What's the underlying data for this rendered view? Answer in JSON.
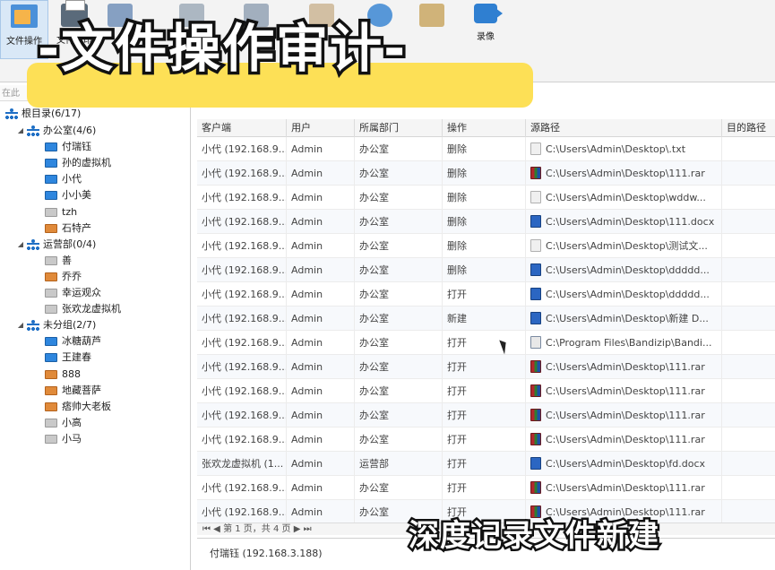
{
  "toolbar": {
    "buttons": [
      {
        "label": "文件操作",
        "icon": "folder-icon",
        "active": true
      },
      {
        "label": "文件打印",
        "icon": "printer-icon"
      },
      {
        "label": "录像",
        "icon": "camera-icon"
      }
    ]
  },
  "banner": "-文件操作审计-",
  "search_strip": "在此",
  "tree": {
    "root": "根目录(6/17)",
    "groups": [
      {
        "name": "办公室(4/6)",
        "items": [
          {
            "name": "付瑞钰",
            "status": "online"
          },
          {
            "name": "孙的虚拟机",
            "status": "online"
          },
          {
            "name": "小代",
            "status": "online"
          },
          {
            "name": "小小美",
            "status": "online"
          },
          {
            "name": "tzh",
            "status": "offline"
          },
          {
            "name": "石特产",
            "status": "warn"
          }
        ]
      },
      {
        "name": "运营部(0/4)",
        "items": [
          {
            "name": "善",
            "status": "offline"
          },
          {
            "name": "乔乔",
            "status": "warn"
          },
          {
            "name": "幸运观众",
            "status": "offline"
          },
          {
            "name": "张欢龙虚拟机",
            "status": "offline"
          }
        ]
      },
      {
        "name": "未分组(2/7)",
        "items": [
          {
            "name": "冰糖葫芦",
            "status": "online"
          },
          {
            "name": "王建春",
            "status": "online"
          },
          {
            "name": "888",
            "status": "warn"
          },
          {
            "name": "地藏菩萨",
            "status": "warn"
          },
          {
            "name": "痞帅大老板",
            "status": "warn"
          },
          {
            "name": "小高",
            "status": "offline"
          },
          {
            "name": "小马",
            "status": "offline"
          }
        ]
      }
    ]
  },
  "table": {
    "headers": [
      "客户端",
      "用户",
      "所属部门",
      "操作",
      "源路径",
      "目的路径"
    ],
    "rows": [
      {
        "client": "小代 (192.168.9...",
        "user": "Admin",
        "dept": "办公室",
        "op": "删除",
        "icon": "txt",
        "path": "C:\\Users\\Admin\\Desktop\\.txt"
      },
      {
        "client": "小代 (192.168.9...",
        "user": "Admin",
        "dept": "办公室",
        "op": "删除",
        "icon": "rar",
        "path": "C:\\Users\\Admin\\Desktop\\111.rar"
      },
      {
        "client": "小代 (192.168.9...",
        "user": "Admin",
        "dept": "办公室",
        "op": "删除",
        "icon": "txt",
        "path": "C:\\Users\\Admin\\Desktop\\wddw..."
      },
      {
        "client": "小代 (192.168.9...",
        "user": "Admin",
        "dept": "办公室",
        "op": "删除",
        "icon": "doc",
        "path": "C:\\Users\\Admin\\Desktop\\111.docx"
      },
      {
        "client": "小代 (192.168.9...",
        "user": "Admin",
        "dept": "办公室",
        "op": "删除",
        "icon": "txt",
        "path": "C:\\Users\\Admin\\Desktop\\测试文..."
      },
      {
        "client": "小代 (192.168.9...",
        "user": "Admin",
        "dept": "办公室",
        "op": "删除",
        "icon": "doc",
        "path": "C:\\Users\\Admin\\Desktop\\ddddd..."
      },
      {
        "client": "小代 (192.168.9...",
        "user": "Admin",
        "dept": "办公室",
        "op": "打开",
        "icon": "doc",
        "path": "C:\\Users\\Admin\\Desktop\\ddddd..."
      },
      {
        "client": "小代 (192.168.9...",
        "user": "Admin",
        "dept": "办公室",
        "op": "新建",
        "icon": "doc",
        "path": "C:\\Users\\Admin\\Desktop\\新建 D..."
      },
      {
        "client": "小代 (192.168.9...",
        "user": "Admin",
        "dept": "办公室",
        "op": "打开",
        "icon": "exe",
        "path": "C:\\Program Files\\Bandizip\\Bandi..."
      },
      {
        "client": "小代 (192.168.9...",
        "user": "Admin",
        "dept": "办公室",
        "op": "打开",
        "icon": "rar",
        "path": "C:\\Users\\Admin\\Desktop\\111.rar"
      },
      {
        "client": "小代 (192.168.9...",
        "user": "Admin",
        "dept": "办公室",
        "op": "打开",
        "icon": "rar",
        "path": "C:\\Users\\Admin\\Desktop\\111.rar"
      },
      {
        "client": "小代 (192.168.9...",
        "user": "Admin",
        "dept": "办公室",
        "op": "打开",
        "icon": "rar",
        "path": "C:\\Users\\Admin\\Desktop\\111.rar"
      },
      {
        "client": "小代 (192.168.9...",
        "user": "Admin",
        "dept": "办公室",
        "op": "打开",
        "icon": "rar",
        "path": "C:\\Users\\Admin\\Desktop\\111.rar"
      },
      {
        "client": "张欢龙虚拟机 (1...",
        "user": "Admin",
        "dept": "运营部",
        "op": "打开",
        "icon": "doc",
        "path": "C:\\Users\\Admin\\Desktop\\fd.docx"
      },
      {
        "client": "小代 (192.168.9...",
        "user": "Admin",
        "dept": "办公室",
        "op": "打开",
        "icon": "rar",
        "path": "C:\\Users\\Admin\\Desktop\\111.rar"
      },
      {
        "client": "小代 (192.168.9...",
        "user": "Admin",
        "dept": "办公室",
        "op": "打开",
        "icon": "rar",
        "path": "C:\\Users\\Admin\\Desktop\\111.rar"
      }
    ]
  },
  "pager": "第 1 页，共 4 页",
  "detail": "付瑞钰 (192.168.3.188)",
  "caption": "深度记录文件新建",
  "colors": {
    "selected": "#d9e8f7",
    "online": "#2e86de",
    "offline": "#c9c9c9",
    "warn": "#e08a3a",
    "banner": "#fde056"
  }
}
